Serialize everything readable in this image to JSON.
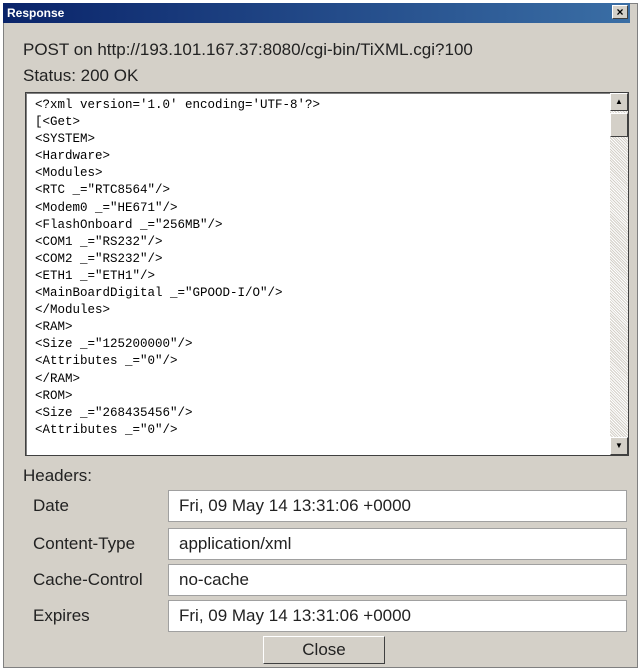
{
  "window": {
    "title": "Response",
    "close_glyph": "×"
  },
  "request": {
    "line": "POST on http://193.101.167.37:8080/cgi-bin/TiXML.cgi?100",
    "status": "Status:  200 OK"
  },
  "body_lines": [
    "<?xml version='1.0' encoding='UTF-8'?>",
    "[<Get>",
    "<SYSTEM>",
    "<Hardware>",
    "<Modules>",
    "<RTC _=\"RTC8564\"/>",
    "<Modem0 _=\"HE671\"/>",
    "<FlashOnboard _=\"256MB\"/>",
    "<COM1 _=\"RS232\"/>",
    "<COM2 _=\"RS232\"/>",
    "<ETH1 _=\"ETH1\"/>",
    "<MainBoardDigital _=\"GPOOD-I/O\"/>",
    "</Modules>",
    "<RAM>",
    "<Size _=\"125200000\"/>",
    "<Attributes _=\"0\"/>",
    "</RAM>",
    "<ROM>",
    "<Size _=\"268435456\"/>",
    "<Attributes _=\"0\"/>"
  ],
  "scrollbar": {
    "up_glyph": "▲",
    "down_glyph": "▼"
  },
  "headers": {
    "label": "Headers:",
    "rows": [
      {
        "key": "Date",
        "value": "Fri, 09 May 14 13:31:06 +0000"
      },
      {
        "key": "Content-Type",
        "value": "application/xml"
      },
      {
        "key": "Cache-Control",
        "value": "no-cache"
      },
      {
        "key": "Expires",
        "value": "Fri, 09 May 14 13:31:06 +0000"
      }
    ]
  },
  "close_label": "Close"
}
